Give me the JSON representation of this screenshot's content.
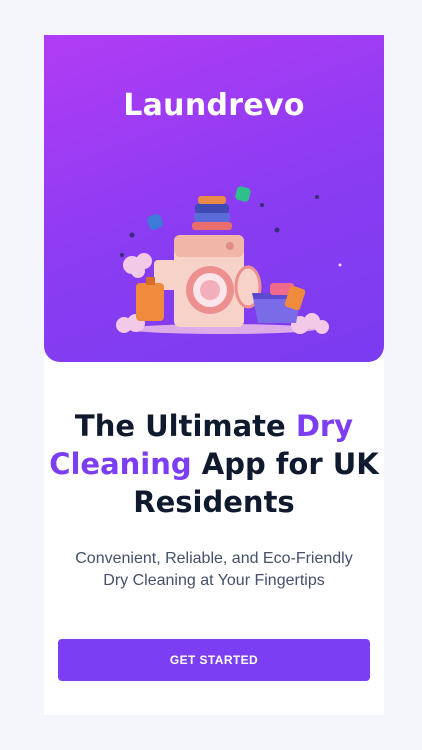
{
  "app": {
    "brand_name": "Laundrevo"
  },
  "hero": {
    "illustration": "washing-machine-laundry-illustration",
    "gradient_start": "#b13cf5",
    "gradient_end": "#7a3bf0"
  },
  "headline": {
    "part1": "The Ultimate ",
    "accent1": "Dry",
    "accent2": "Cleaning",
    "part2": " App for UK",
    "part3": "Residents",
    "accent_color": "#7b3ef2"
  },
  "subtitle": {
    "line1": "Convenient, Reliable, and Eco-Friendly",
    "line2": "Dry Cleaning at Your Fingertips"
  },
  "cta": {
    "label": "GET STARTED",
    "color": "#7b3ef2"
  }
}
